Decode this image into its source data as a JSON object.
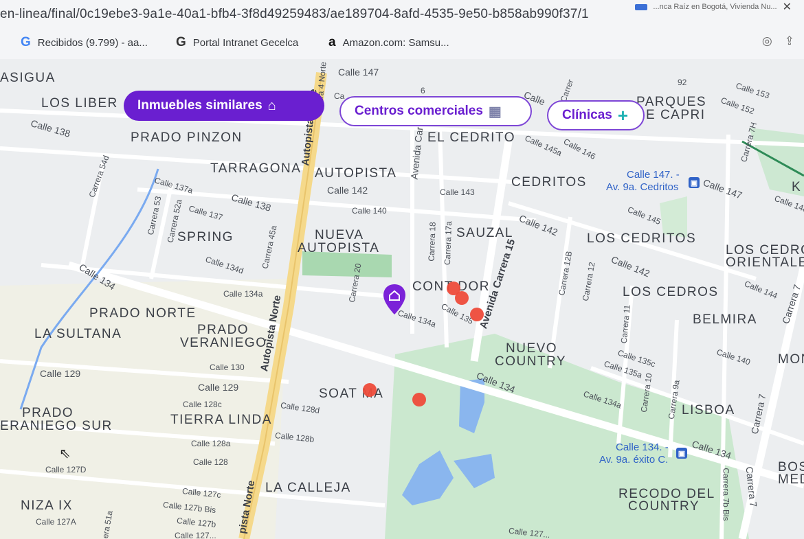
{
  "browser": {
    "url": "en-linea/final/0c19ebe3-9a1e-40a1-bfb4-3f8d49259483/ae189704-8afd-4535-9e50-b858ab990f37/1",
    "top_right_text": "...nca Raíz en Bogotá, Vivienda Nu...",
    "bookmarks": [
      {
        "icon": "G",
        "label": "Recibidos (9.799) - aa..."
      },
      {
        "icon": "G",
        "label": "Portal Intranet Gecelca"
      },
      {
        "icon": "a",
        "label": "Amazon.com: Samsu..."
      }
    ]
  },
  "filters": {
    "similar": {
      "label": "Inmuebles similares",
      "icon": "home-icon"
    },
    "malls": {
      "label": "Centros comerciales",
      "icon": "mall-icon"
    },
    "clinics": {
      "label": "Clínicas",
      "icon": "plus-icon"
    }
  },
  "map": {
    "neighborhoods": {
      "asigua": "ASIGUA",
      "los_liber": "LOS LIBER",
      "prado_pinzon": "PRADO PINZON",
      "tarragona": "TARRAGONA",
      "autopista": "AUTOPISTA",
      "el_cedrito": "EL CEDRITO",
      "parques_capri_1": "PARQUES",
      "parques_capri_2": "E CAPRI",
      "cedritos": "CEDRITOS",
      "spring": "SPRING",
      "nueva_autopista_1": "NUEVA",
      "nueva_autopista_2": "AUTOPISTA",
      "sauzal": "SAUZAL",
      "los_cedritos": "LOS CEDRITOS",
      "los_cedros_or_1": "LOS CEDROS",
      "los_cedros_or_2": "ORIENTALES",
      "contador": "CONT DOR",
      "los_cedros": "LOS CEDROS",
      "prado_norte": "PRADO NORTE",
      "belmira": "BELMIRA",
      "la_sultana": "LA SULTANA",
      "prado_veraniego_1": "PRADO",
      "prado_veraniego_2": "VERANIEGO",
      "nuevo_country_1": "NUEVO",
      "nuevo_country_2": "COUNTRY",
      "mon": "MON",
      "soatama": "SOAT MA",
      "lisboa": "LISBOA",
      "prado_veraniego_sur_1": "PRADO",
      "prado_veraniego_sur_2": "ERANIEGO SUR",
      "tierra_linda": "TIERRA LINDA",
      "la_calleja": "LA CALLEJA",
      "bos_med_1": "BOS",
      "bos_med_2": "MED",
      "niza_ix": "NIZA IX",
      "recodo_1": "RECODO DEL",
      "recodo_2": "COUNTRY",
      "k": "K"
    },
    "streets": {
      "calle147_top": "Calle 147",
      "calle138_left": "Calle 138",
      "calle137a": "Calle 137a",
      "calle138_mid": "Calle 138",
      "calle137": "Calle 137",
      "calle142_a": "Calle 142",
      "calle140": "Calle 140",
      "calle143": "Calle 143",
      "calle145a": "Calle 145a",
      "calle146": "Calle 146",
      "calle147_right": "Calle 147",
      "calle148": "Calle 148",
      "calle153": "Calle 153",
      "calle152": "Calle 152",
      "calle145": "Calle 145",
      "calle142_b": "Calle 142",
      "calle142_c": "Calle 142",
      "calle134_left": "Calle 134",
      "calle134d": "Calle 134d",
      "calle134a_left": "Calle 134a",
      "calle134a_mid": "Calle 134a",
      "calle135": "Calle 135",
      "calle144": "Calle 144",
      "calle135c": "Calle 135c",
      "calle135a": "Calle 135a",
      "calle140_right": "Calle 140",
      "calle130": "Calle 130",
      "calle129_left": "Calle 129",
      "calle129_mid": "Calle 129",
      "calle128c": "Calle 128c",
      "calle128d": "Calle 128d",
      "calle134_mid": "Calle 134",
      "calle134a_right": "Calle 134a",
      "calle128a": "Calle 128a",
      "calle128b": "Calle 128b",
      "calle128": "Calle 128",
      "calle134_right": "Calle 134",
      "calle127d": "Calle 127D",
      "calle127c": "Calle 127c",
      "calle127bbis": "Calle 127b Bis",
      "calle127b": "Calle 127b",
      "calle127a": "Calle 127A",
      "calle127_bottom": "Calle 127...",
      "calle127_cut": "Calle 127...",
      "carrera54d": "Carrera 54d",
      "carrera53": "Carrera 53",
      "carrera52a": "Carrera 52a",
      "carrera45a": "Carrera 45a",
      "carrera20": "Carrera 20",
      "carrera18": "Carrera 18",
      "carrera17a": "Carrera 17a",
      "carrera12b": "Carrera 12B",
      "carrera12": "Carrera 12",
      "carrera11": "Carrera 11",
      "carrera10": "Carrera 10",
      "carrera9a": "Carrera 9a",
      "carrera7h": "Carrera 7H",
      "carrera7_right": "Carrera 7",
      "carrera7_low": "Carrera 7",
      "carrera7b_bis": "Carrera 7b Bis",
      "carrera7_bottom": "Carrera 7",
      "carrera_cut": "Carrer",
      "era51a": "era 51a",
      "ara4_norte": "ara 4 Norte",
      "av_car": "Avenida Car",
      "ca": "Ca",
      "calle_cut": "Calle",
      "six": "6",
      "calle_cut_top": "Calle ...",
      "n92": "92"
    },
    "highways": {
      "autopista_norte_top": "Autopista Norte",
      "autopista_norte_mid": "Autopista Norte",
      "autopista_norte_bottom": "pista Norte",
      "avenida_carrera15": "Avenida Carrera 15"
    },
    "transit": {
      "stop1_line1": "Calle 147. -",
      "stop1_line2": "Av. 9a. Cedritos",
      "stop2_line1": "Calle 134. -",
      "stop2_line2": "Av. 9a. éxito C."
    },
    "markers": {
      "property_pin": "home-pin",
      "similar_count": 5
    }
  }
}
